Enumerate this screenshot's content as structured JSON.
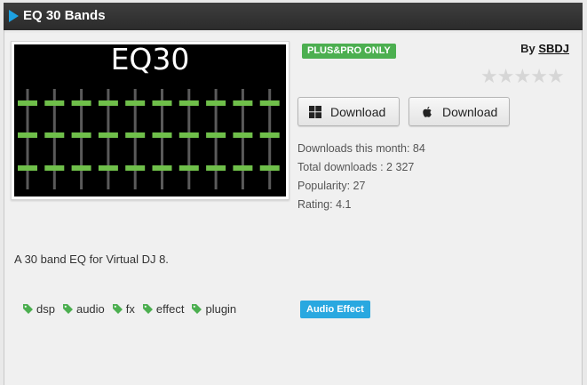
{
  "window": {
    "title": "EQ 30 Bands"
  },
  "thumbnail": {
    "label": "EQ30",
    "columns": 10,
    "rows": 3,
    "bg": "#000000",
    "accent": "#6fbf4a"
  },
  "badges": {
    "plan": "PLUS&PRO ONLY",
    "plan_color": "#4caf50",
    "type": "Audio Effect",
    "type_color": "#29a8e0"
  },
  "author": {
    "prefix": "By",
    "name": "SBDJ"
  },
  "rating_stars": {
    "filled": 0,
    "total": 5
  },
  "buttons": {
    "windows_download": "Download",
    "mac_download": "Download"
  },
  "stats": {
    "month": "Downloads this month: 84",
    "total": "Total downloads : 2 327",
    "popularity": "Popularity: 27",
    "rating": "Rating: 4.1"
  },
  "description": "A 30 band EQ for Virtual DJ 8.",
  "tags": [
    "dsp",
    "audio",
    "fx",
    "effect",
    "plugin"
  ],
  "colors": {
    "tag_icon": "#4caf50",
    "titlebar_arrow": "#1da1e2"
  }
}
